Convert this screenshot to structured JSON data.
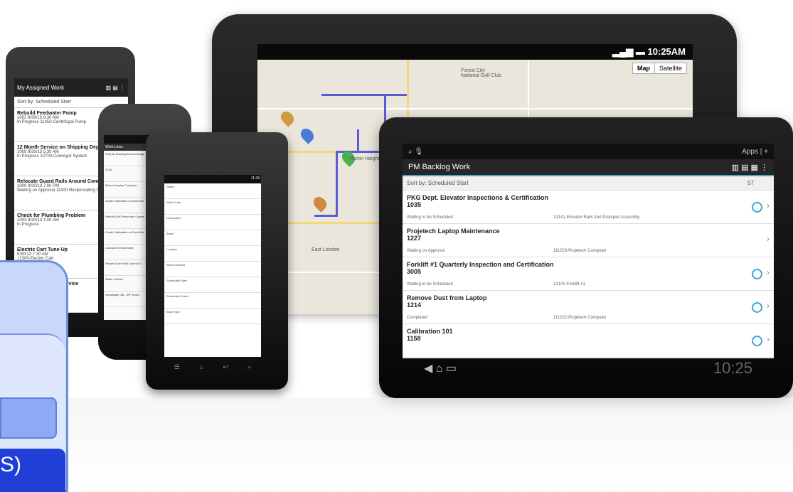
{
  "map_tablet": {
    "time": "10:25AM",
    "map_type": [
      "Map",
      "Satellite"
    ],
    "labels": [
      "Forest City National Golf Club",
      "Huron Heights",
      "East London"
    ]
  },
  "tablet": {
    "title": "PM Backlog Work",
    "apps_label": "Apps",
    "sort_label": "Sort by: Scheduled Start",
    "count": "57",
    "clock": "10:25",
    "items": [
      {
        "title": "PKG Dept. Elevator Inspections & Certification",
        "number": "1035",
        "status": "Waiting to be Scheduled",
        "asset": "13141-Elevator Rails And Drainpan Assembly",
        "timer": true
      },
      {
        "title": "Projetech Laptop Maintenance",
        "number": "1227",
        "status": "Waiting on Approval",
        "asset": "111223-Projetech Computer",
        "timer": false
      },
      {
        "title": "Forklift #1 Quarterly Inspection and Certification",
        "number": "3005",
        "status": "Waiting to be Scheduled",
        "asset": "12100-Forklift #1",
        "timer": true
      },
      {
        "title": "Remove Dust from Laptop",
        "number": "1214",
        "status": "Completed",
        "asset": "111222-Projetech Computer",
        "timer": true
      },
      {
        "title": "Calibration 101",
        "number": "1158",
        "status": "",
        "asset": "",
        "timer": true
      }
    ]
  },
  "left_phone": {
    "title": "My Assigned Work",
    "sort_label": "Sort by: Scheduled Start",
    "items": [
      {
        "title": "Rebuild Feedwater Pump",
        "number": "1002",
        "date": "9/30/13 9:30 AM",
        "status": "In Progress",
        "asset": "11450-Centrifugal Pump"
      },
      {
        "title": "12 Month Service on Shipping Dept #2...",
        "number": "1009",
        "date": "9/30/13 5:30 AM",
        "status": "In Progress",
        "asset": "12700-Conveyor System"
      },
      {
        "title": "Relocate Guard Rails Around Compre...",
        "number": "1000",
        "date": "9/30/13 7:00 PM",
        "status": "Waiting on Approval",
        "asset": "11300-Reciprocating Co"
      },
      {
        "title": "Check for Plumbing Problem",
        "number": "1003",
        "date": "9/30/13 3:00 AM",
        "status": "In Progress",
        "asset": ""
      },
      {
        "title": "Electric Cart Tune-Up",
        "number": "",
        "date": "9/30/13 7:30 AM",
        "status": "",
        "asset": "12300-Electric Cart"
      },
      {
        "title": "ervice",
        "number": "",
        "date": "",
        "status": "",
        "asset": ""
      }
    ]
  },
  "mid_phone": {
    "time": "3:42 PM",
    "title": "Work Lines",
    "rows": [
      "Rebuild Building Access Bridge",
      "1216",
      "Reboot Laptop Computer",
      "Grade Calibration on Dock lifts",
      "Reboot Cell Phone and Cancel",
      "Grade Calibration on Dock lifts",
      "Conduct Exit Interview",
      "Repair Guard Rail Around #1",
      "Water on floor",
      "Investigate QB - IRP Down"
    ]
  },
  "front_phone": {
    "time": "11:33",
    "fields": [
      "Status",
      "Work Order",
      "Description",
      "Asset",
      "Location",
      "Street Address",
      "Scheduled Start",
      "Scheduled Finish",
      "Work Type"
    ]
  },
  "overlay": {
    "text": "S)"
  }
}
